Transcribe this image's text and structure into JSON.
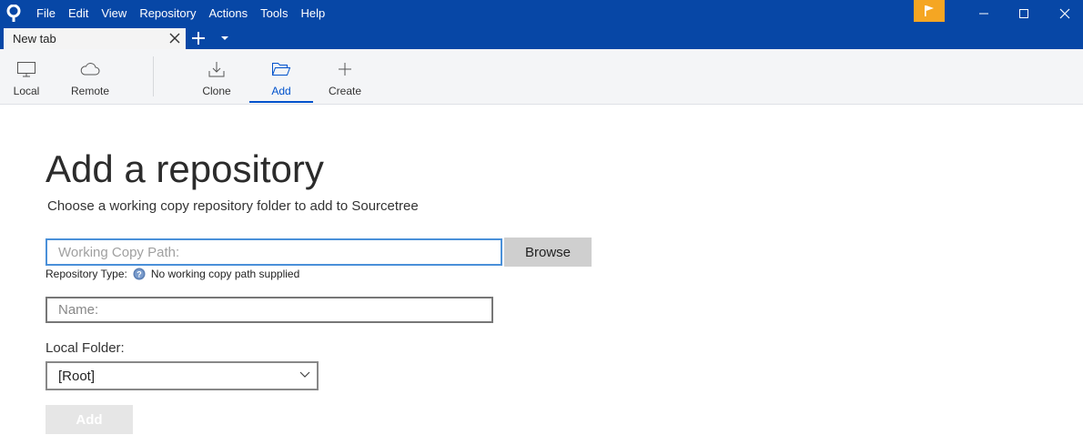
{
  "colors": {
    "titlebar": "#0747a6",
    "accent": "#0052cc",
    "flag": "#f5a623"
  },
  "menu": [
    "File",
    "Edit",
    "View",
    "Repository",
    "Actions",
    "Tools",
    "Help"
  ],
  "tab": {
    "label": "New tab"
  },
  "toolbar": {
    "local": "Local",
    "remote": "Remote",
    "clone": "Clone",
    "add": "Add",
    "create": "Create",
    "active": "Add"
  },
  "page": {
    "title": "Add a repository",
    "subtitle": "Choose a working copy repository folder to add to Sourcetree"
  },
  "form": {
    "path_placeholder": "Working Copy Path:",
    "path_value": "",
    "browse_label": "Browse",
    "repo_type_label": "Repository Type:",
    "repo_type_value": "No working copy path supplied",
    "name_placeholder": "Name:",
    "name_value": "",
    "local_folder_label": "Local Folder:",
    "local_folder_value": "[Root]",
    "add_label": "Add"
  }
}
